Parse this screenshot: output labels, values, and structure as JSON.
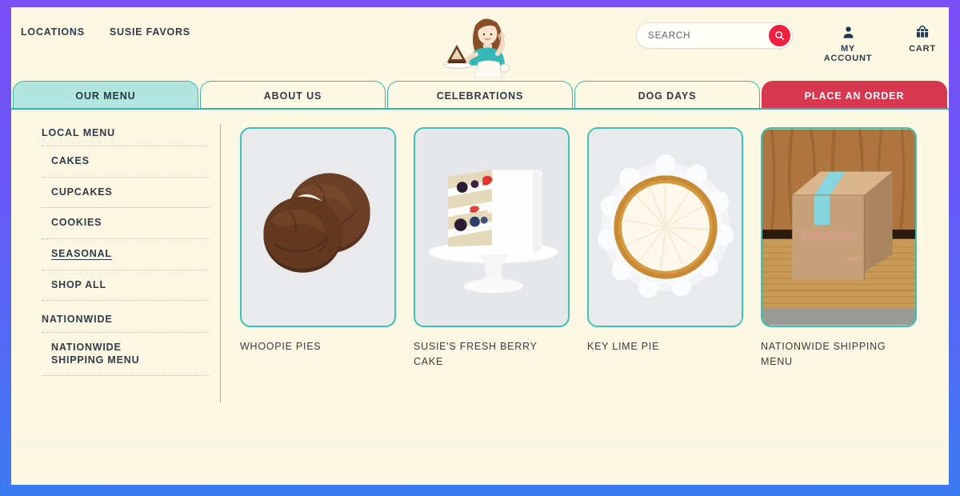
{
  "brand": {
    "logo_alt": "susie-cakes-logo",
    "colors": {
      "page_bg": "#fdf8e4",
      "teal": "#35b8a8",
      "active_tab": "#b2e5de",
      "order_red": "#d8384f",
      "search_red": "#f02040",
      "text": "#2f3a4a",
      "frame_top": "#7b4ff5",
      "frame_bottom": "#3b7bf0"
    }
  },
  "header": {
    "utility_links": [
      {
        "label": "LOCATIONS",
        "name": "locations"
      },
      {
        "label": "SUSIE FAVORS",
        "name": "susie-favors"
      }
    ],
    "search": {
      "placeholder": "SEARCH",
      "value": "",
      "button_icon": "search-icon"
    },
    "actions": [
      {
        "label": "MY ACCOUNT",
        "icon": "user-icon",
        "name": "my-account"
      },
      {
        "label": "CART",
        "icon": "basket-icon",
        "name": "cart"
      }
    ]
  },
  "tabs": [
    {
      "label": "OUR MENU",
      "name": "our-menu",
      "state": "active"
    },
    {
      "label": "ABOUT US",
      "name": "about-us",
      "state": "default"
    },
    {
      "label": "CELEBRATIONS",
      "name": "celebrations",
      "state": "default"
    },
    {
      "label": "DOG DAYS",
      "name": "dog-days",
      "state": "default"
    },
    {
      "label": "PLACE AN ORDER",
      "name": "place-an-order",
      "state": "cta"
    }
  ],
  "sidebar": {
    "groups": [
      {
        "title": "LOCAL MENU",
        "name": "local-menu",
        "items": [
          {
            "label": "CAKES",
            "name": "cakes",
            "active": false
          },
          {
            "label": "CUPCAKES",
            "name": "cupcakes",
            "active": false
          },
          {
            "label": "COOKIES",
            "name": "cookies",
            "active": false
          },
          {
            "label": "SEASONAL",
            "name": "seasonal",
            "active": true
          },
          {
            "label": "SHOP ALL",
            "name": "shop-all",
            "active": false
          }
        ]
      },
      {
        "title": "NATIONWIDE",
        "name": "nationwide",
        "items": [
          {
            "label": "NATIONWIDE SHIPPING MENU",
            "name": "nationwide-shipping-menu",
            "active": false
          }
        ]
      }
    ]
  },
  "products": [
    {
      "label": "WHOOPIE PIES",
      "name": "whoopie-pies",
      "image": "chocolate-whoopie-pies-photo"
    },
    {
      "label": "SUSIE'S FRESH BERRY CAKE",
      "name": "susies-fresh-berry-cake",
      "image": "white-berry-layer-cake-photo"
    },
    {
      "label": "KEY LIME PIE",
      "name": "key-lime-pie",
      "image": "key-lime-pie-photo"
    },
    {
      "label": "NATIONWIDE SHIPPING MENU",
      "name": "nationwide-shipping-menu-card",
      "image": "shipping-box-on-doormat-photo"
    }
  ]
}
